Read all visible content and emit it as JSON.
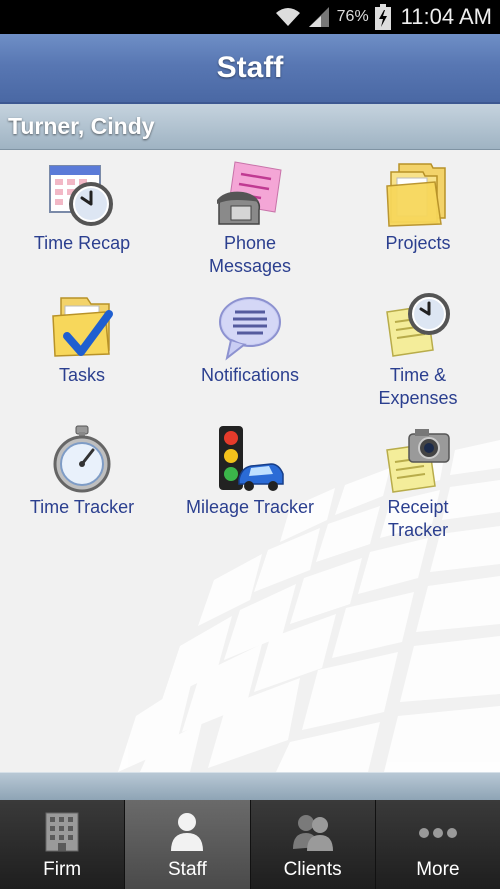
{
  "status_bar": {
    "battery_percent": "76%",
    "time": "11:04 AM"
  },
  "header": {
    "title": "Staff"
  },
  "user": {
    "name": "Turner, Cindy"
  },
  "tiles": [
    {
      "label": "Time Recap",
      "icon": "calendar-clock-icon"
    },
    {
      "label": "Phone\nMessages",
      "icon": "phone-message-icon"
    },
    {
      "label": "Projects",
      "icon": "folders-icon"
    },
    {
      "label": "Tasks",
      "icon": "folder-check-icon"
    },
    {
      "label": "Notifications",
      "icon": "speech-bubble-icon"
    },
    {
      "label": "Time &\nExpenses",
      "icon": "notes-clock-icon"
    },
    {
      "label": "Time Tracker",
      "icon": "stopwatch-icon"
    },
    {
      "label": "Mileage Tracker",
      "icon": "traffic-light-car-icon"
    },
    {
      "label": "Receipt\nTracker",
      "icon": "camera-receipt-icon"
    }
  ],
  "tab_bar": {
    "tabs": [
      {
        "label": "Firm",
        "icon": "building-icon",
        "active": false
      },
      {
        "label": "Staff",
        "icon": "person-icon",
        "active": true
      },
      {
        "label": "Clients",
        "icon": "people-icon",
        "active": false
      },
      {
        "label": "More",
        "icon": "more-dots-icon",
        "active": false
      }
    ]
  },
  "colors": {
    "title_bar": "#5877b3",
    "tile_label": "#2b3f8f",
    "user_header": "#9fb3c3"
  }
}
